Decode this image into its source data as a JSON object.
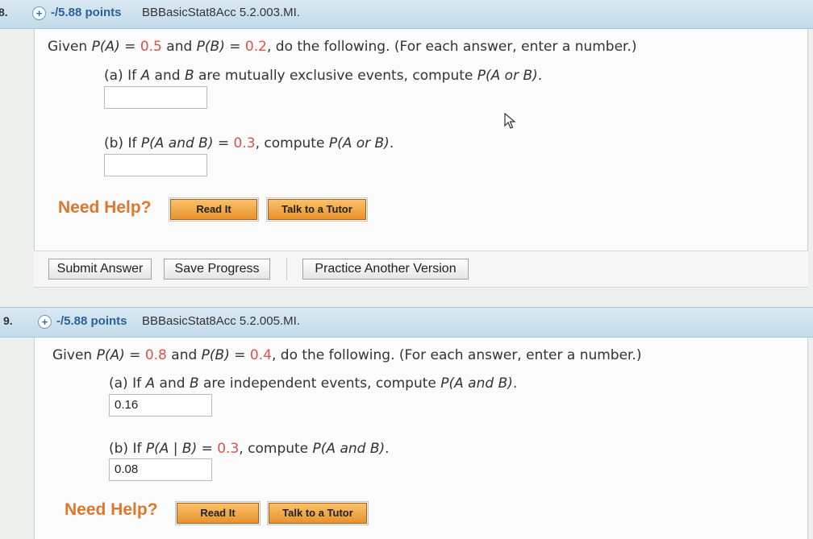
{
  "q8": {
    "number": "8.",
    "points": "-/5.88 points",
    "code": "BBBasicStat8Acc 5.2.003.MI.",
    "stem_pre": "Given ",
    "stem_pa": "P(A)",
    "stem_eq1": " = ",
    "stem_va": "0.5",
    "stem_and": " and ",
    "stem_pb": "P(B)",
    "stem_eq2": " = ",
    "stem_vb": "0.2",
    "stem_post": ", do the following. (For each answer, enter a number.)",
    "a_label": "(a) If ",
    "a_A": "A",
    "a_and": " and ",
    "a_B": "B",
    "a_text": " are mutually exclusive events, compute ",
    "a_target": "P(A or B)",
    "a_end": ".",
    "a_value": "",
    "b_label": "(b) If ",
    "b_cond": "P(A and B)",
    "b_eq": " = ",
    "b_val": "0.3",
    "b_text": ", compute ",
    "b_target": "P(A or B)",
    "b_end": ".",
    "b_value": "",
    "need_help": "Need Help?",
    "read_it": "Read It",
    "tutor": "Talk to a Tutor"
  },
  "actions": {
    "submit": "Submit Answer",
    "save": "Save Progress",
    "practice": "Practice Another Version"
  },
  "q9": {
    "number": "9.",
    "points": "-/5.88 points",
    "code": "BBBasicStat8Acc 5.2.005.MI.",
    "stem_pre": "Given ",
    "stem_pa": "P(A)",
    "stem_eq1": " = ",
    "stem_va": "0.8",
    "stem_and": " and ",
    "stem_pb": "P(B)",
    "stem_eq2": " = ",
    "stem_vb": "0.4",
    "stem_post": ", do the following. (For each answer, enter a number.)",
    "a_label": "(a) If ",
    "a_A": "A",
    "a_and": " and ",
    "a_B": "B",
    "a_text": " are independent events, compute ",
    "a_target": "P(A and B)",
    "a_end": ".",
    "a_value": "0.16",
    "b_label": "(b) If ",
    "b_cond": "P(A | B)",
    "b_eq": " = ",
    "b_val": "0.3",
    "b_text": ", compute ",
    "b_target": "P(A and B)",
    "b_end": ".",
    "b_value": "0.08",
    "need_help": "Need Help?",
    "read_it": "Read It",
    "tutor": "Talk to a Tutor"
  },
  "icons": {
    "expand": "plus-circle-icon",
    "pointer": "mouse-cursor-icon"
  },
  "colors": {
    "value_red": "#d9534f",
    "points_blue": "#2e5f9a",
    "help_orange": "#e0762c"
  }
}
